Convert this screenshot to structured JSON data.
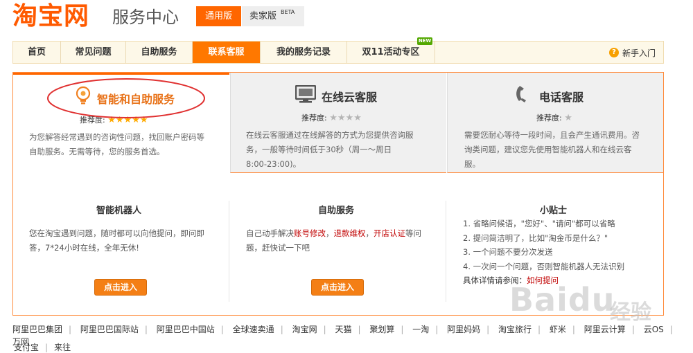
{
  "header": {
    "logo": "淘宝网",
    "service_center": "服务中心",
    "tab_general": "通用版",
    "tab_seller": "卖家版",
    "tab_seller_badge": "BETA"
  },
  "nav": {
    "items": [
      "首页",
      "常见问题",
      "自助服务",
      "联系客服",
      "我的服务记录",
      "双11活动专区"
    ],
    "active": "联系客服",
    "new_badge": "NEW",
    "help": "新手入门"
  },
  "channels": [
    {
      "title": "智能和自助服务",
      "rating_label": "推荐度:",
      "stars": 5,
      "desc_lines": [
        "为您解答经常遇到的咨询性问题，找回账户密码等",
        "自助服务。无需等待，您的服务首选。"
      ]
    },
    {
      "title": "在线云客服",
      "rating_label": "推荐度:",
      "stars": 4,
      "desc_lines": [
        "在线云客服通过在线解答的方式为您提供咨询服",
        "务，一般等待时间低于30秒（周一～周日",
        "8:00-23:00)。"
      ]
    },
    {
      "title": "电话客服",
      "rating_label": "推荐度:",
      "stars": 1,
      "desc_lines": [
        "需要您耐心等待一段时间，且会产生通讯费用。咨",
        "询类问题，建议您先使用智能机器人和在线云客",
        "服。"
      ]
    }
  ],
  "sections": {
    "robot": {
      "title": "智能机器人",
      "desc_lines": [
        "您在淘宝遇到问题，随时都可以向他提问，即问即",
        "答，7*24小时在线，全年无休!"
      ],
      "button": "点击进入"
    },
    "self": {
      "title": "自助服务",
      "desc_prefix": "自己动手解决",
      "links": [
        "账号修改",
        "退款维权",
        "开店认证"
      ],
      "sep": "，",
      "desc_suffix": "等问",
      "desc_line2": "题，赶快试一下吧",
      "button": "点击进入"
    },
    "tips": {
      "title": "小贴士",
      "items": [
        "1. 省略问候语，\"您好\"、\"请问\"都可以省略",
        "2. 提问简洁明了，比如\"淘金币是什么？\"",
        "3. 一个问题不要分次发送",
        "4. 一次问一个问题，否则智能机器人无法识别"
      ],
      "more_label": "具体详情请参阅：",
      "more_link": "如何提问"
    }
  },
  "footer": {
    "links": [
      "阿里巴巴集团",
      "阿里巴巴国际站",
      "阿里巴巴中国站",
      "全球速卖通",
      "淘宝网",
      "天猫",
      "聚划算",
      "一淘",
      "阿里妈妈",
      "淘宝旅行",
      "虾米",
      "阿里云计算",
      "云OS",
      "万网"
    ],
    "links_row2": [
      "支付宝",
      "来往"
    ]
  },
  "watermark": {
    "text": "Baidu",
    "suffix": "经验"
  },
  "colors": {
    "brand": "#ff5a00",
    "accent": "#ff7800",
    "link_red": "#c00000",
    "star": "#ffaa00",
    "annotation_circle": "#e03030"
  }
}
